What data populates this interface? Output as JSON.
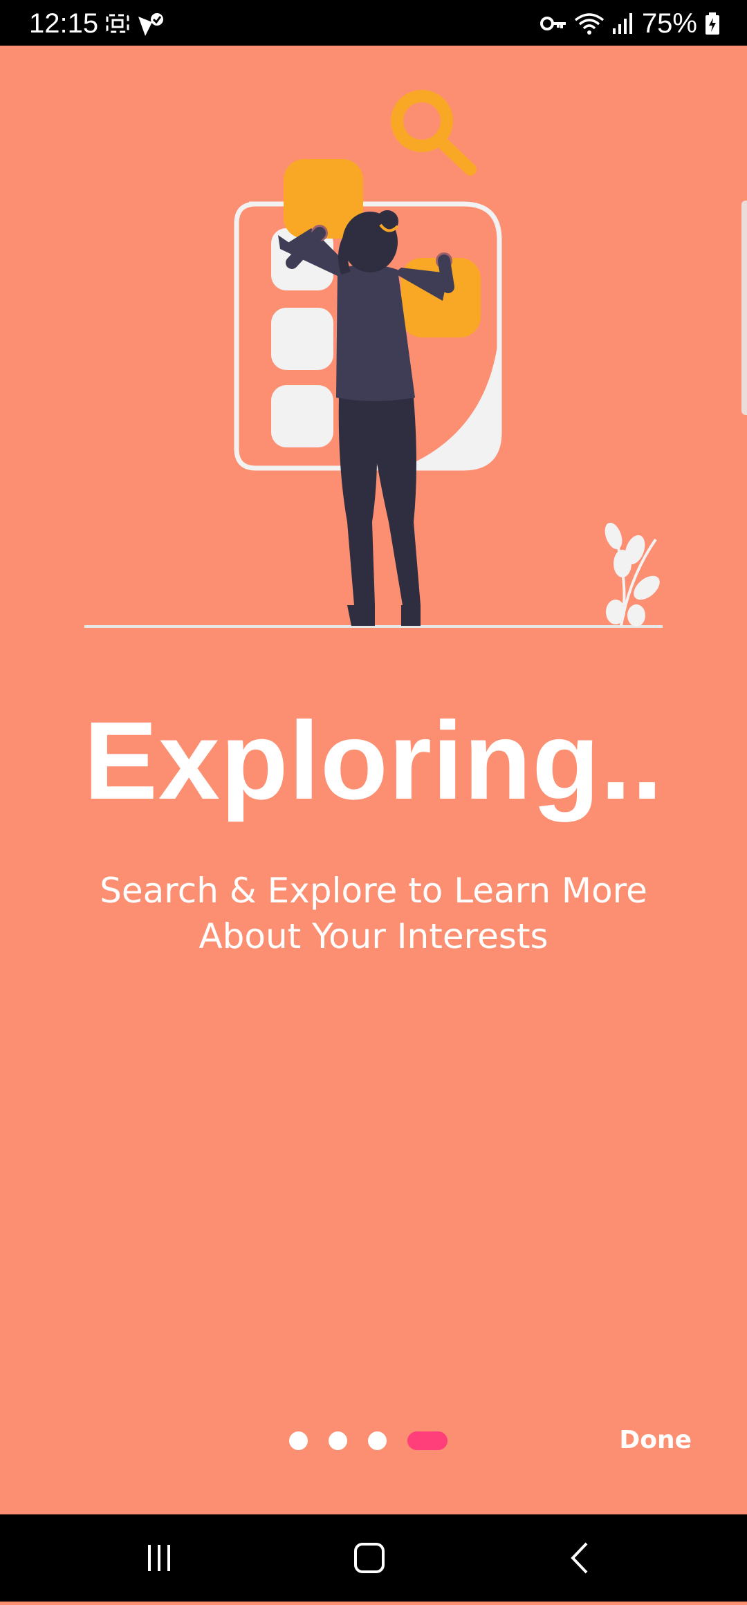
{
  "status_bar": {
    "time": "12:15",
    "battery": "75%",
    "icons": [
      "screenshot-icon",
      "vpn-check-icon",
      "key-icon",
      "wifi-icon",
      "signal-icon",
      "battery-icon"
    ]
  },
  "onboarding": {
    "title": "Exploring..",
    "subtitle_line1": "Search & Explore to Learn More",
    "subtitle_line2": "About Your Interests",
    "page_count": 4,
    "active_page": 4,
    "done_label": "Done"
  },
  "nav_bar": {
    "buttons": [
      "recent-apps-icon",
      "home-icon",
      "back-icon"
    ]
  },
  "colors": {
    "background": "#fc8f72",
    "accent": "#ff3f7a",
    "yellow": "#f9a826",
    "figure": "#3f3d56"
  }
}
